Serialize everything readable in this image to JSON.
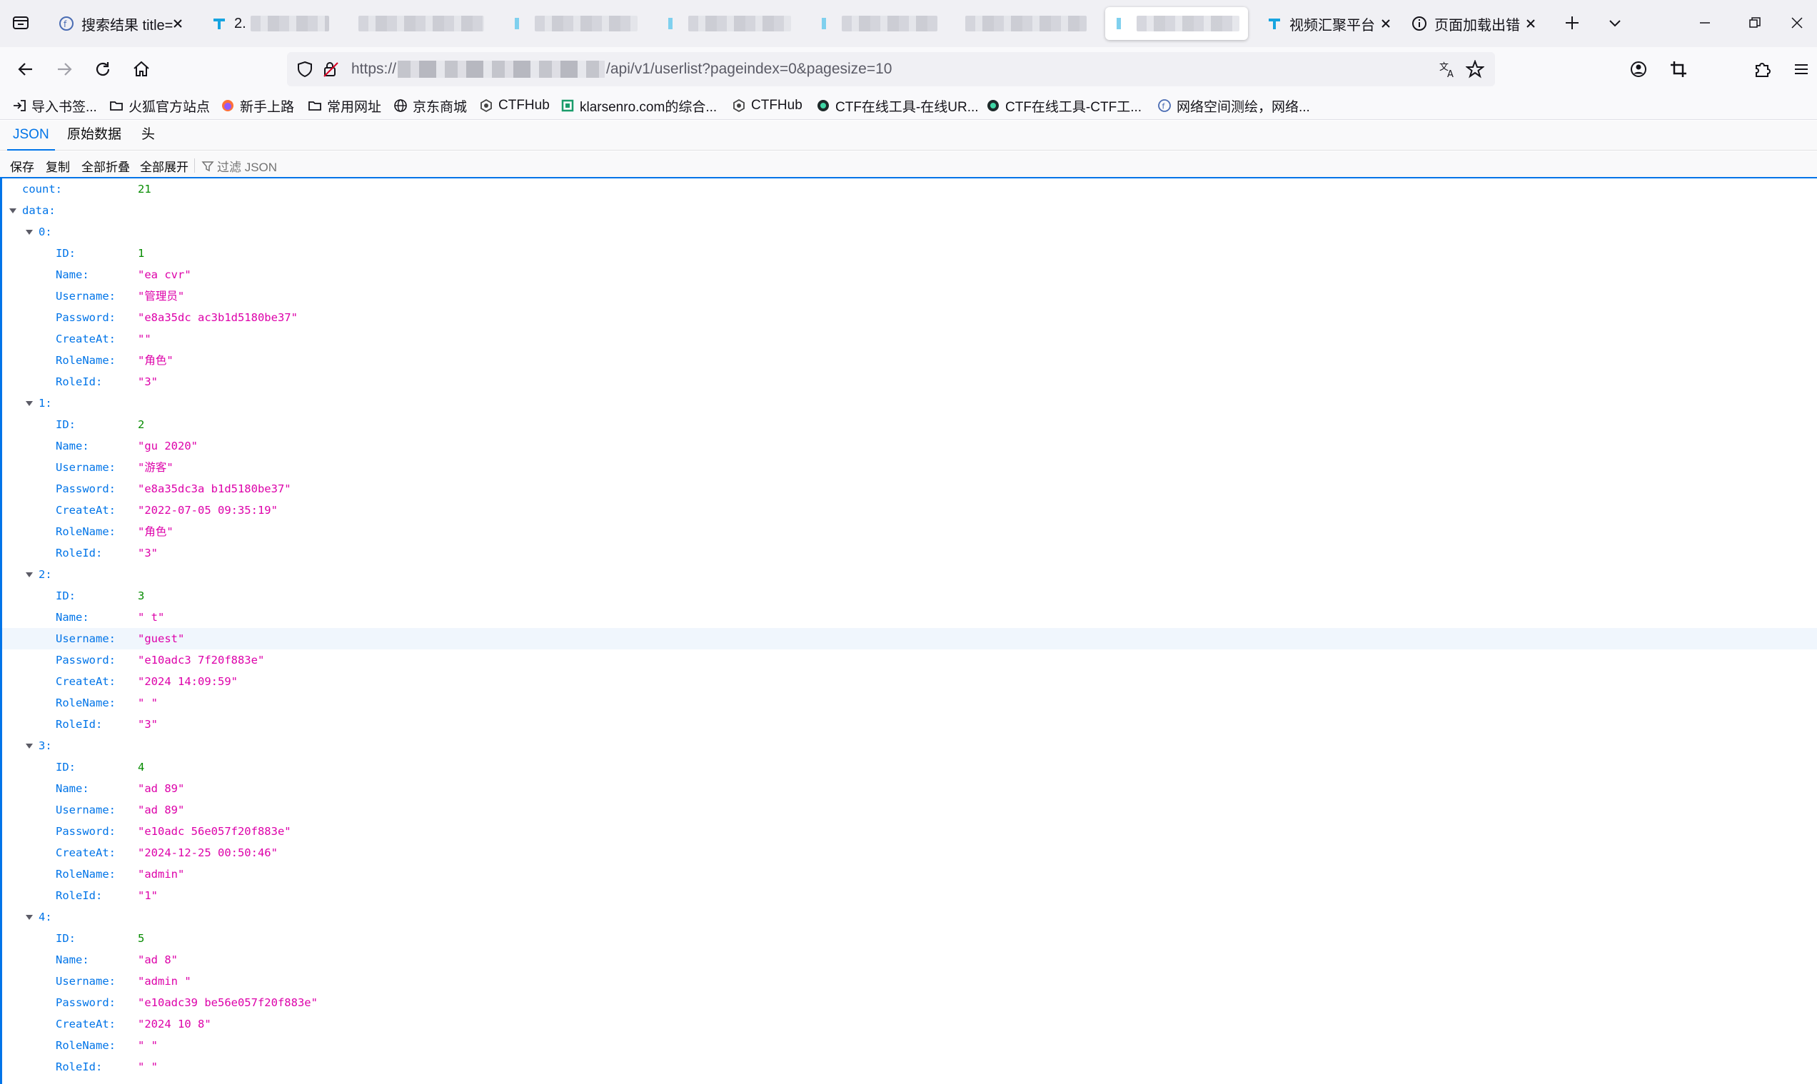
{
  "tabs": [
    {
      "title": "搜索结果 title=",
      "has_close": true
    },
    {
      "title": "2.",
      "has_close": false
    },
    {
      "title": "",
      "has_close": false
    },
    {
      "title": "",
      "has_close": false
    },
    {
      "title": "",
      "has_close": false
    },
    {
      "title": "",
      "has_close": false
    },
    {
      "title": "",
      "has_close": false
    },
    {
      "title": "",
      "has_close": false,
      "active": true
    },
    {
      "title": "视频汇聚平台",
      "has_close": true
    },
    {
      "title": "页面加载出错",
      "has_close": true
    }
  ],
  "nav": {
    "url_prefix": "https://",
    "url_path": "/api/v1/userlist?pageindex=0&pagesize=10"
  },
  "bookmarks": [
    {
      "label": "导入书签...",
      "icon": "import-icon"
    },
    {
      "label": "火狐官方站点",
      "icon": "folder-icon"
    },
    {
      "label": "新手上路",
      "icon": "firefox-icon"
    },
    {
      "label": "常用网址",
      "icon": "folder-icon"
    },
    {
      "label": "京东商城",
      "icon": "globe-icon"
    },
    {
      "label": "CTFHub",
      "icon": "ctfhub-icon"
    },
    {
      "label": "klarsenro.com的综合...",
      "icon": "klarsenro-icon"
    },
    {
      "label": "CTFHub",
      "icon": "ctfhub-icon"
    },
    {
      "label": "CTF在线工具-在线UR...",
      "icon": "ctf-tool-icon"
    },
    {
      "label": "CTF在线工具-CTF工...",
      "icon": "ctf-tool-icon"
    },
    {
      "label": "网络空间测绘，网络...",
      "icon": "fofa-icon"
    }
  ],
  "viewer": {
    "tabs": [
      "JSON",
      "原始数据",
      "头"
    ],
    "toolbar": [
      "保存",
      "复制",
      "全部折叠",
      "全部展开"
    ],
    "filter_placeholder": "过滤 JSON"
  },
  "json": {
    "count_key": "count:",
    "count_value": "21",
    "data_key": "data:",
    "items": [
      {
        "index": "0:",
        "fields": [
          {
            "key": "ID:",
            "value": "1",
            "type": "num"
          },
          {
            "key": "Name:",
            "value": "\"ea  cvr\"",
            "type": "str"
          },
          {
            "key": "Username:",
            "value": "\"管理员\"",
            "type": "str"
          },
          {
            "key": "Password:",
            "value": "\"e8a35dc          ac3b1d5180be37\"",
            "type": "str"
          },
          {
            "key": "CreateAt:",
            "value": "\"\"",
            "type": "str"
          },
          {
            "key": "RoleName:",
            "value": "\"角色\"",
            "type": "str"
          },
          {
            "key": "RoleId:",
            "value": "\"3\"",
            "type": "str"
          }
        ]
      },
      {
        "index": "1:",
        "fields": [
          {
            "key": "ID:",
            "value": "2",
            "type": "num"
          },
          {
            "key": "Name:",
            "value": "\"gu   2020\"",
            "type": "str"
          },
          {
            "key": "Username:",
            "value": "\"游客\"",
            "type": "str"
          },
          {
            "key": "Password:",
            "value": "\"e8a35dc3a          b1d5180be37\"",
            "type": "str"
          },
          {
            "key": "CreateAt:",
            "value": "\"2022-07-05 09:35:19\"",
            "type": "str"
          },
          {
            "key": "RoleName:",
            "value": "\"角色\"",
            "type": "str"
          },
          {
            "key": "RoleId:",
            "value": "\"3\"",
            "type": "str"
          }
        ]
      },
      {
        "index": "2:",
        "fields": [
          {
            "key": "ID:",
            "value": "3",
            "type": "num"
          },
          {
            "key": "Name:",
            "value": "\"   t\"",
            "type": "str"
          },
          {
            "key": "Username:",
            "value": "\"guest\"",
            "type": "str",
            "highlight": true
          },
          {
            "key": "Password:",
            "value": "\"e10adc3               7f20f883e\"",
            "type": "str"
          },
          {
            "key": "CreateAt:",
            "value": "\"2024     14:09:59\"",
            "type": "str"
          },
          {
            "key": "RoleName:",
            "value": "\"     \"",
            "type": "str"
          },
          {
            "key": "RoleId:",
            "value": "\"3\"",
            "type": "str"
          }
        ]
      },
      {
        "index": "3:",
        "fields": [
          {
            "key": "ID:",
            "value": "4",
            "type": "num"
          },
          {
            "key": "Name:",
            "value": "\"ad    89\"",
            "type": "str"
          },
          {
            "key": "Username:",
            "value": "\"ad    89\"",
            "type": "str"
          },
          {
            "key": "Password:",
            "value": "\"e10adc          56e057f20f883e\"",
            "type": "str"
          },
          {
            "key": "CreateAt:",
            "value": "\"2024-12-25 00:50:46\"",
            "type": "str"
          },
          {
            "key": "RoleName:",
            "value": "\"admin\"",
            "type": "str"
          },
          {
            "key": "RoleId:",
            "value": "\"1\"",
            "type": "str"
          }
        ]
      },
      {
        "index": "4:",
        "fields": [
          {
            "key": "ID:",
            "value": "5",
            "type": "num"
          },
          {
            "key": "Name:",
            "value": "\"ad    8\"",
            "type": "str"
          },
          {
            "key": "Username:",
            "value": "\"admin   \"",
            "type": "str"
          },
          {
            "key": "Password:",
            "value": "\"e10adc39       be56e057f20f883e\"",
            "type": "str"
          },
          {
            "key": "CreateAt:",
            "value": "\"2024     10     8\"",
            "type": "str"
          },
          {
            "key": "RoleName:",
            "value": "\"     \"",
            "type": "str"
          },
          {
            "key": "RoleId:",
            "value": "\"  \"",
            "type": "str"
          }
        ]
      }
    ]
  },
  "colors": {
    "accent": "#0074e8",
    "string": "#dd00a9",
    "number": "#058b00",
    "key": "#0074e8"
  }
}
